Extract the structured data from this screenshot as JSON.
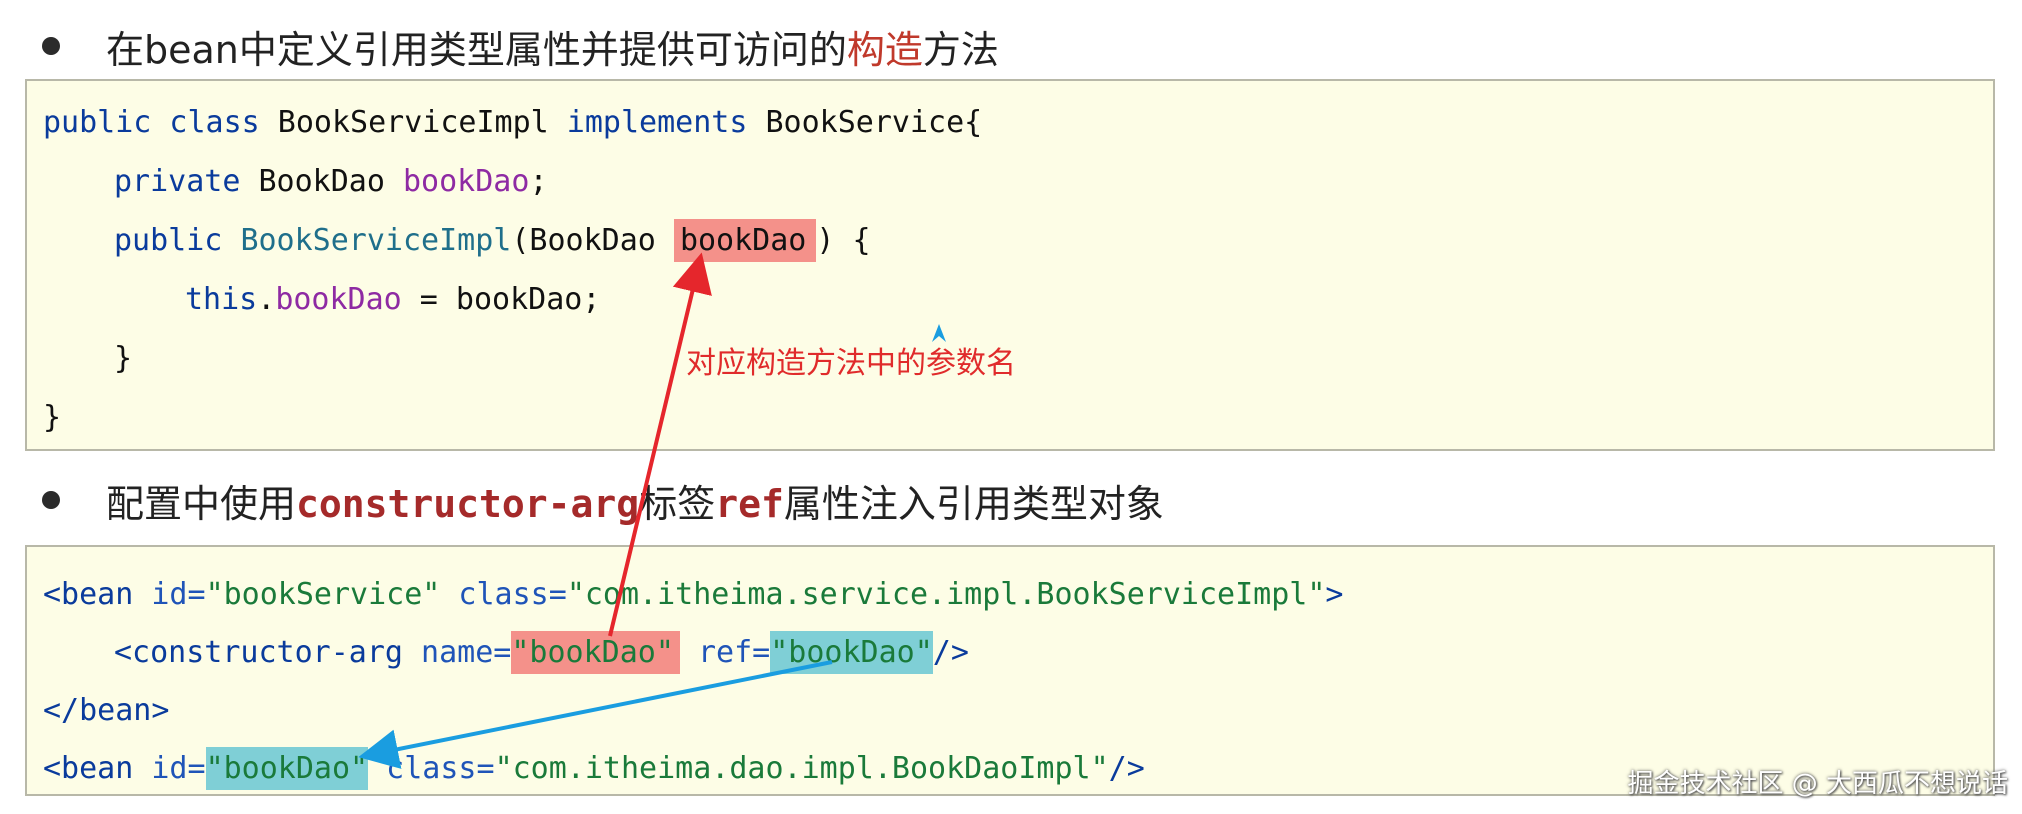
{
  "bullet1": {
    "pre": "在bean中定义引用类型属性并提供可访问的",
    "hl": "构造",
    "post": "方法"
  },
  "code1": {
    "l1": {
      "a": "public class",
      "b": " BookServiceImpl ",
      "c": "implements",
      "d": " BookService{"
    },
    "l2": {
      "a": "private",
      "b": " BookDao ",
      "c": "bookDao",
      "d": ";"
    },
    "l3": {
      "a": "public",
      "b": "BookServiceImpl",
      "c": "(BookDao ",
      "d": "bookDao",
      "e": ") {"
    },
    "l4": {
      "a": "this",
      "b": ".",
      "c": "bookDao",
      "d": " = bookDao;"
    },
    "l5": "}",
    "l6": "}"
  },
  "annotation": "对应构造方法中的参数名",
  "bullet2": {
    "pre": "配置中使用",
    "kw1": "constructor-arg",
    "mid": "标签",
    "kw2": "ref",
    "post": "属性注入引用类型对象"
  },
  "code2": {
    "l1": {
      "a": "<bean ",
      "b": "id=",
      "c": "\"bookService\"",
      "d": " class=",
      "e": "\"com.itheima.service.impl.BookServiceImpl\"",
      "f": ">"
    },
    "l2": {
      "a": "<constructor-arg ",
      "b": "name=",
      "c": "\"bookDao\"",
      "d": " ref=",
      "e": "\"bookDao\"",
      "f": "/>"
    },
    "l3": "</bean>",
    "l4": {
      "a": "<bean ",
      "b": "id=",
      "c": "\"bookDao\"",
      "d": " class=",
      "e": "\"com.itheima.dao.impl.BookDaoImpl\"",
      "f": "/>"
    }
  },
  "watermark": "掘金技术社区 @ 大西瓜不想说话",
  "colors": {
    "arrow_red": "#e5262c",
    "arrow_blue": "#1a9de0",
    "highlight_red": "#f4918a",
    "highlight_cyan": "#7fcfd6"
  }
}
